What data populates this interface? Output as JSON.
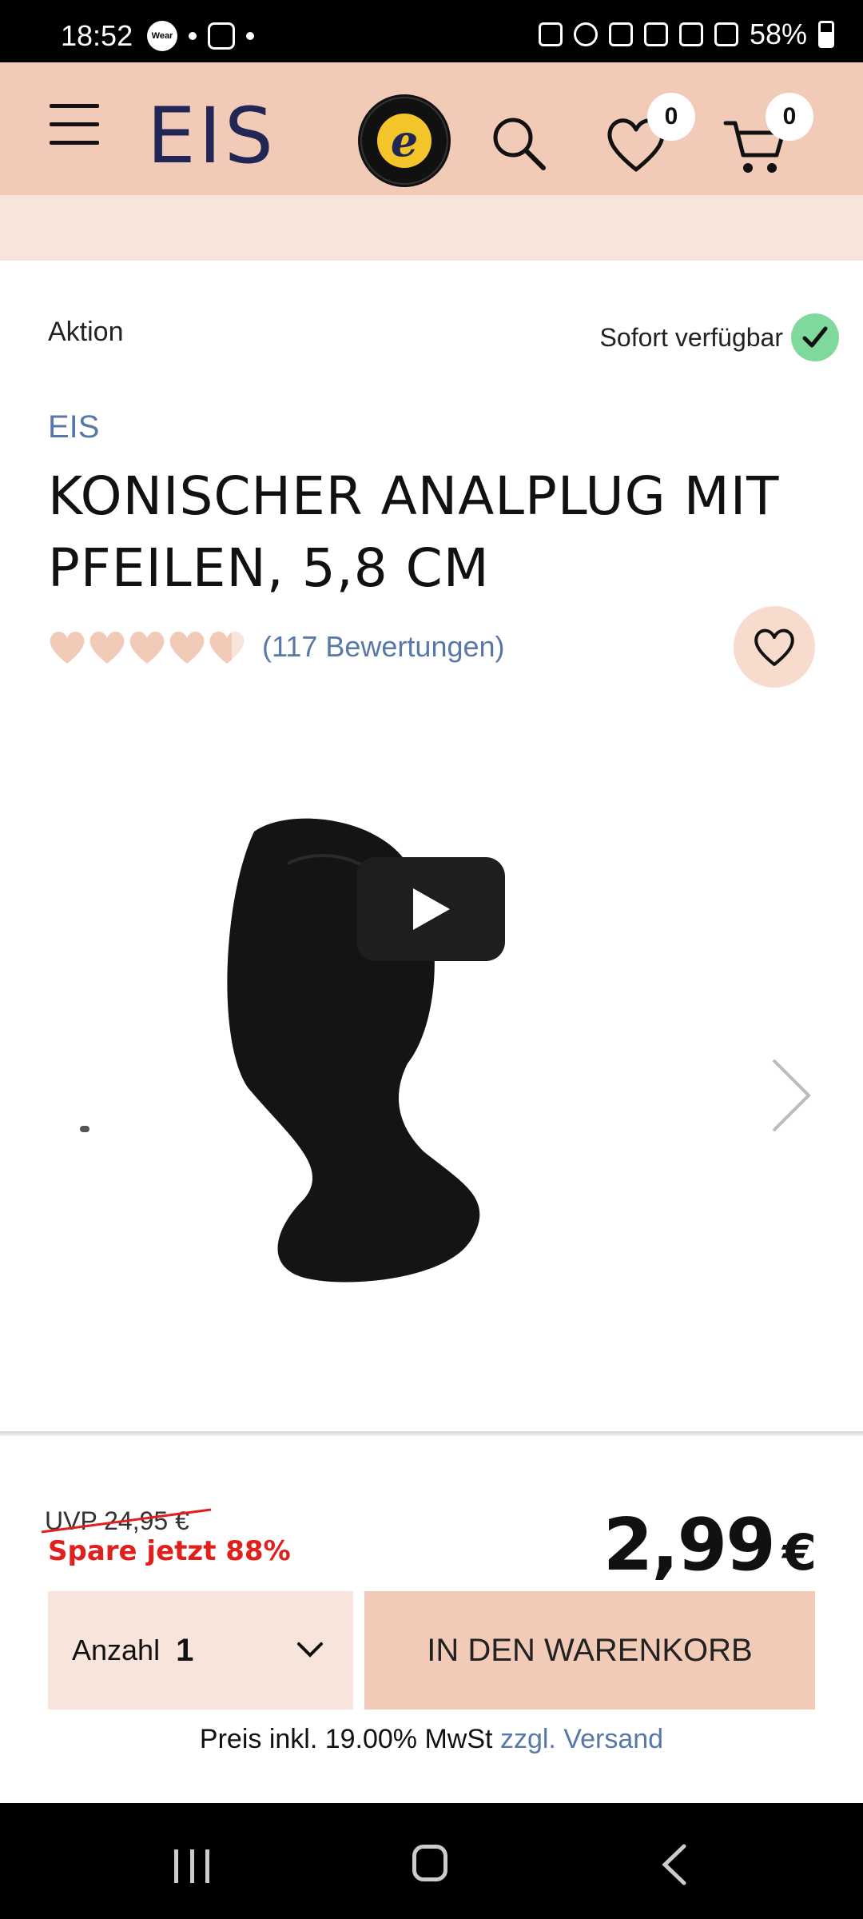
{
  "status_bar": {
    "time": "18:52",
    "battery": "58%",
    "left_icons": [
      "wear-icon",
      "google-assistant-icon",
      "instagram-icon",
      "dot-icon"
    ],
    "right_icons": [
      "recycle-icon",
      "alarm-icon",
      "mute-icon",
      "wifi-icon",
      "call-icon",
      "signal-icon",
      "battery-icon"
    ]
  },
  "header": {
    "logo": "EIS",
    "trusted_shops_letter": "e",
    "wishlist_count": "0",
    "cart_count": "0",
    "background_color": "#f2cbb8"
  },
  "product": {
    "promo_label": "Aktion",
    "availability": "Sofort verfügbar",
    "brand": "EIS",
    "title": "KONISCHER ANALPLUG MIT PFEILEN, 5,8 CM",
    "reviews": "(117 Bewertungen)",
    "rating": 4.5,
    "max_rating": 5,
    "image_icon": "product-photo",
    "video_icon": "play-icon"
  },
  "purchase": {
    "uvp": "UVP 24,95 €",
    "savings": "Spare jetzt 88%",
    "price": "2,99",
    "currency": "€",
    "quantity_label": "Anzahl",
    "quantity_value": "1",
    "add_to_cart": "IN DEN WARENKORB",
    "tax_text": "Preis inkl. 19.00% MwSt",
    "shipping_link": "zzgl. Versand"
  },
  "colors": {
    "accent": "#f2cbb8",
    "link": "#5878a8",
    "sale": "#e0201d",
    "stock_check": "#7fd99c"
  }
}
